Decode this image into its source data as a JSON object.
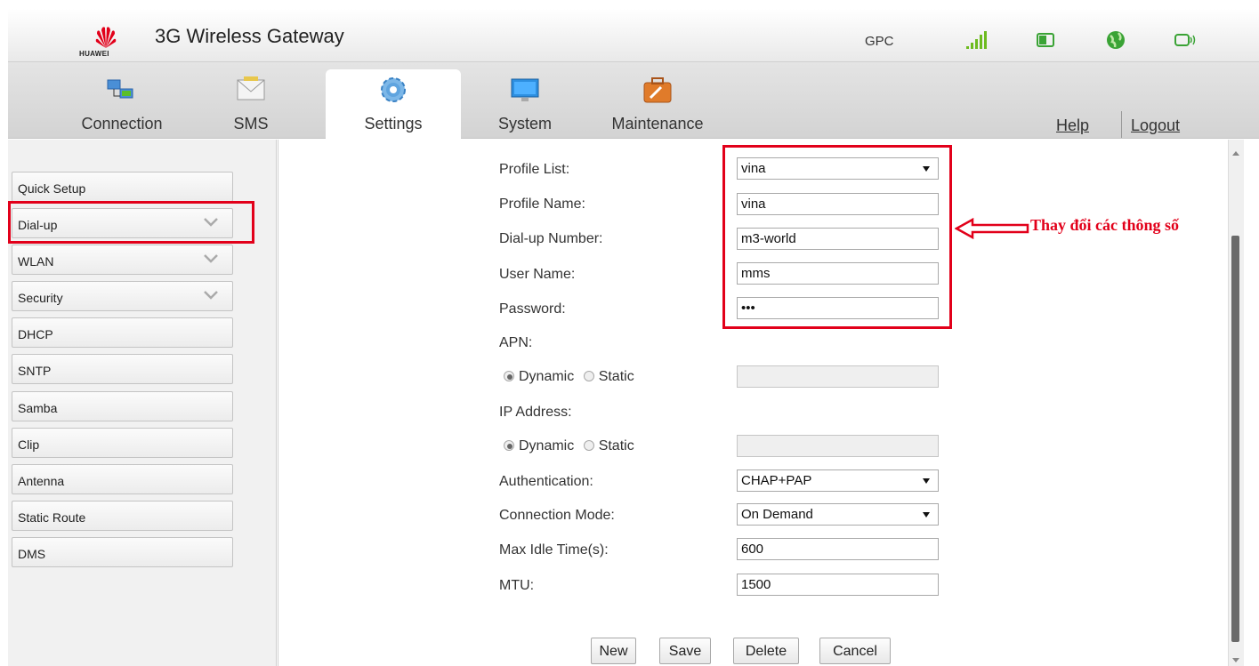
{
  "header": {
    "brand": "HUAWEI",
    "title": "3G Wireless Gateway",
    "operator": "GPC"
  },
  "nav": {
    "tabs": [
      {
        "label": "Connection",
        "icon": "connection-icon"
      },
      {
        "label": "SMS",
        "icon": "envelope-icon"
      },
      {
        "label": "Settings",
        "icon": "gear-icon",
        "active": true
      },
      {
        "label": "System",
        "icon": "monitor-icon"
      },
      {
        "label": "Maintenance",
        "icon": "toolbox-icon"
      }
    ],
    "help": "Help",
    "logout": "Logout"
  },
  "sidebar": {
    "items": [
      {
        "label": "Quick Setup",
        "expandable": false
      },
      {
        "label": "Dial-up",
        "expandable": true
      },
      {
        "label": "WLAN",
        "expandable": true
      },
      {
        "label": "Security",
        "expandable": true
      },
      {
        "label": "DHCP",
        "expandable": false
      },
      {
        "label": "SNTP",
        "expandable": false
      },
      {
        "label": "Samba",
        "expandable": false
      },
      {
        "label": "Clip",
        "expandable": false
      },
      {
        "label": "Antenna",
        "expandable": false
      },
      {
        "label": "Static Route",
        "expandable": false
      },
      {
        "label": "DMS",
        "expandable": false
      }
    ]
  },
  "form": {
    "profile_list": {
      "label": "Profile List:",
      "value": "vina"
    },
    "profile_name": {
      "label": "Profile Name:",
      "value": "vina"
    },
    "dialup_number": {
      "label": "Dial-up Number:",
      "value": "m3-world"
    },
    "user_name": {
      "label": "User Name:",
      "value": "mms"
    },
    "password": {
      "label": "Password:",
      "value": "•••"
    },
    "apn": {
      "label": "APN:",
      "dynamic": "Dynamic",
      "static": "Static",
      "selected": "Dynamic"
    },
    "ip_address": {
      "label": "IP Address:",
      "dynamic": "Dynamic",
      "static": "Static",
      "selected": "Dynamic"
    },
    "authentication": {
      "label": "Authentication:",
      "value": "CHAP+PAP"
    },
    "connection_mode": {
      "label": "Connection Mode:",
      "value": "On Demand"
    },
    "max_idle": {
      "label": "Max Idle Time(s):",
      "value": "600"
    },
    "mtu": {
      "label": "MTU:",
      "value": "1500"
    }
  },
  "buttons": {
    "new": "New",
    "save": "Save",
    "delete": "Delete",
    "cancel": "Cancel"
  },
  "annotation": "Thay đổi các thông số",
  "colors": {
    "highlight": "#e2001a",
    "signal": "#6dbb1f",
    "brand_red": "#e2001a"
  }
}
